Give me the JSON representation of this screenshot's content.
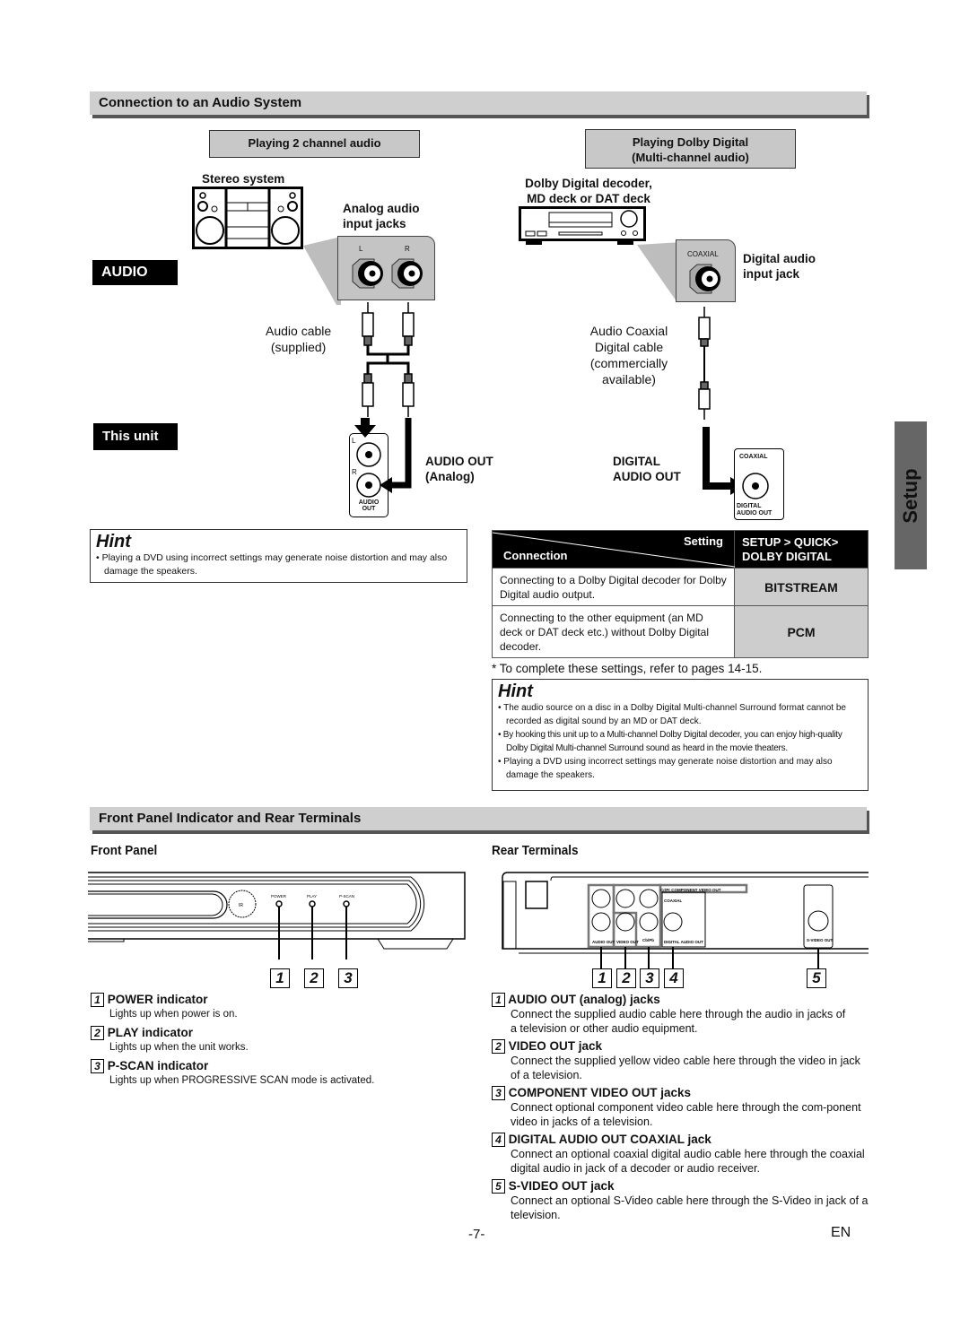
{
  "section1": {
    "title": "Connection to an Audio System",
    "left_box": "Playing 2 channel audio",
    "right_box_line1": "Playing Dolby Digital",
    "right_box_line2": "(Multi-channel audio)",
    "stereo_label": "Stereo system",
    "analog_in_line1": "Analog audio",
    "analog_in_line2": "input jacks",
    "jack_l": "L",
    "jack_r": "R",
    "audio_label": "AUDIO",
    "this_unit_label": "This unit",
    "audio_cable_line1": "Audio cable",
    "audio_cable_line2": "(supplied)",
    "audio_out_line1": "AUDIO OUT",
    "audio_out_line2": "(Analog)",
    "unit_jack_label_l": "L",
    "unit_jack_label_r": "R",
    "unit_jack_caption_1": "AUDIO",
    "unit_jack_caption_2": "OUT",
    "decoder_line1": "Dolby  Digital  decoder,",
    "decoder_line2": "MD deck or DAT deck",
    "coaxial_label": "COAXIAL",
    "digital_in_line1": "Digital audio",
    "digital_in_line2": "input jack",
    "coax_cable_lines": [
      "Audio Coaxial",
      "Digital cable",
      "(commercially",
      "available)"
    ],
    "digital_out_line1": "DIGITAL",
    "digital_out_line2": "AUDIO OUT",
    "unit_coax_label": "COAXIAL",
    "unit_coax_caption_1": "DIGITAL",
    "unit_coax_caption_2": "AUDIO OUT"
  },
  "hint_left": {
    "title": "Hint",
    "items": [
      "Playing a DVD using incorrect settings may generate noise distortion and may also damage the speakers."
    ]
  },
  "settings_table": {
    "header_connection": "Connection",
    "header_setting": "Setting",
    "header_value_line1": "SETUP > QUICK>",
    "header_value_line2": "DOLBY DIGITAL",
    "rows": [
      {
        "connection": "Connecting to a Dolby Digital decoder for Dolby Digital audio output.",
        "value": "BITSTREAM"
      },
      {
        "connection": "Connecting to the other equipment (an MD deck or DAT deck etc.) without Dolby Digital decoder.",
        "value": "PCM"
      }
    ],
    "footnote": "* To complete these settings, refer to pages 14-15."
  },
  "hint_right": {
    "title": "Hint",
    "items": [
      "The audio source on a disc in a Dolby Digital Multi-channel Surround format cannot be recorded as digital sound by an MD or DAT deck.",
      "By hooking this unit up to a Multi-channel Dolby Digital decoder, you can enjoy high-quality Dolby Digital Multi-channel Surround sound as heard in the movie theaters.",
      "Playing a DVD using incorrect settings may generate noise distortion and may also damage the speakers."
    ]
  },
  "side_tab": "Setup",
  "section2": {
    "title": "Front Panel Indicator and Rear Terminals",
    "front_panel_heading": "Front Panel",
    "rear_terminals_heading": "Rear Terminals",
    "front_panel_labels": {
      "ir": "IR",
      "power": "POWER",
      "play": "PLAY",
      "pscan": "P-SCAN"
    },
    "rear_labels": {
      "component": "Cr/Pr   COMPONENT  VIDEO OUT",
      "coaxial": "COAXIAL",
      "audio_out": "AUDIO OUT",
      "video_out": "VIDEO OUT",
      "cbpb": "Cb/Pb",
      "digital_audio_out": "DIGITAL AUDIO OUT",
      "svideo_out": "S-VIDEO OUT"
    },
    "front_items": [
      {
        "num": "1",
        "title": "POWER indicator",
        "desc": "Lights up when power is on."
      },
      {
        "num": "2",
        "title": "PLAY indicator",
        "desc": "Lights up when the unit works."
      },
      {
        "num": "3",
        "title": "P-SCAN indicator",
        "desc": "Lights up when PROGRESSIVE SCAN mode is activated."
      }
    ],
    "rear_items": [
      {
        "num": "1",
        "title": "AUDIO OUT (analog) jacks",
        "desc": "Connect the supplied audio cable here through the audio in jacks of a television or other audio equipment."
      },
      {
        "num": "2",
        "title": "VIDEO OUT jack",
        "desc": "Connect the supplied yellow video cable here through the video in jack of a television."
      },
      {
        "num": "3",
        "title": "COMPONENT VIDEO OUT jacks",
        "desc": "Connect optional component video cable here through the com-ponent video in jacks of a television."
      },
      {
        "num": "4",
        "title": "DIGITAL AUDIO OUT COAXIAL jack",
        "desc": "Connect an optional coaxial digital audio cable here through the coaxial digital audio in jack of a decoder or audio receiver."
      },
      {
        "num": "5",
        "title": "S-VIDEO OUT jack",
        "desc": "Connect an optional S-Video cable here through the S-Video in jack of a television."
      }
    ],
    "front_callouts": [
      "1",
      "2",
      "3"
    ],
    "rear_callouts": [
      "1",
      "2",
      "3",
      "4",
      "5"
    ]
  },
  "footer": {
    "page_number": "-7-",
    "language": "EN"
  }
}
